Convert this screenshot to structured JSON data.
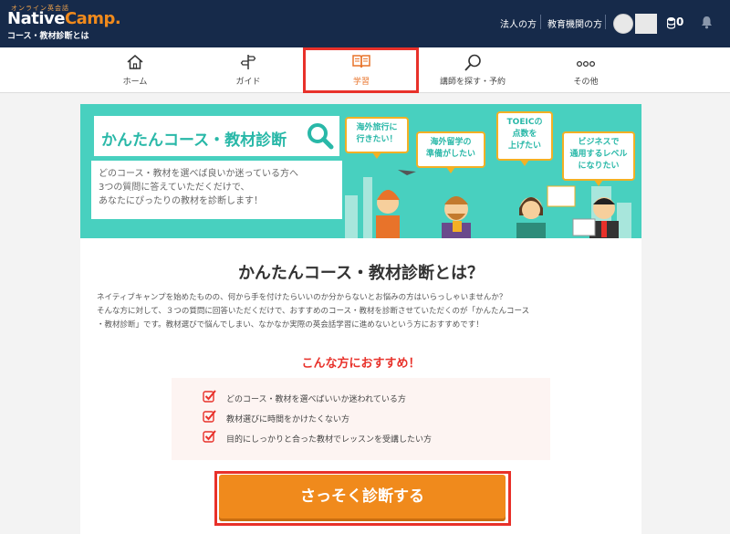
{
  "header": {
    "logo_small": "オンライン英会話",
    "logo_main": "Native",
    "logo_accent": "Camp.",
    "subtitle": "コース・教材診断とは",
    "corporate_link": "法人の方",
    "education_link": "教育機関の方",
    "coin_count": "0"
  },
  "nav": {
    "items": [
      {
        "label": "ホーム",
        "icon": "home-icon"
      },
      {
        "label": "ガイド",
        "icon": "signpost-icon"
      },
      {
        "label": "学習",
        "icon": "book-icon"
      },
      {
        "label": "講師を探す・予約",
        "icon": "search-icon"
      },
      {
        "label": "その他",
        "icon": "more-icon"
      }
    ],
    "active": "学習"
  },
  "banner": {
    "title": "かんたんコース・教材診断",
    "desc_line1": "どのコース・教材を選べば良いか迷っている方へ",
    "desc_line2": "3つの質問に答えていただくだけで、",
    "desc_line3": "あなたにぴったりの教材を診断します！",
    "bubbles": [
      [
        "海外旅行に",
        "行きたい！"
      ],
      [
        "海外留学の",
        "準備がしたい"
      ],
      [
        "TOEICの",
        "点数を",
        "上げたい"
      ],
      [
        "ビジネスで",
        "通用するレベル",
        "になりたい"
      ]
    ]
  },
  "main": {
    "heading": "かんたんコース・教材診断とは？",
    "para_line1": "ネイティブキャンプを始めたものの、何から手を付けたらいいのか分からないとお悩みの方はいらっしゃいませんか？",
    "para_line2": "そんな方に対して、３つの質問に回答いただくだけで、おすすめのコース・教材を診断させていただくのが「かんたんコース",
    "para_line3": "・教材診断」です。教材選びで悩んでしまい、なかなか実際の英会話学習に進めないという方におすすめです！",
    "recommend_title": "こんな方におすすめ！",
    "recommend_items": [
      "どのコース・教材を選べばいいか迷われている方",
      "教材選びに時間をかけたくない方",
      "目的にしっかりと合った教材でレッスンを受講したい方"
    ],
    "cta_label": "さっそく診断する"
  },
  "colors": {
    "header_bg": "#162a4a",
    "accent_orange": "#f08a1c",
    "teal": "#48d0bf",
    "highlight_red": "#e8312a"
  }
}
